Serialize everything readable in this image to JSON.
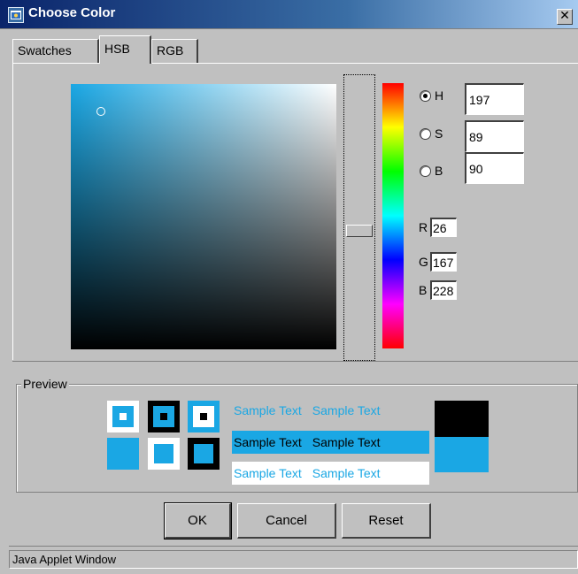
{
  "window": {
    "title": "Choose Color",
    "close_label": "✕"
  },
  "tabs": [
    {
      "label": "Swatches",
      "active": false
    },
    {
      "label": "HSB",
      "active": true
    },
    {
      "label": "RGB",
      "active": false
    }
  ],
  "hsb": {
    "selected_mode": "H",
    "h": {
      "label": "H",
      "value": "197"
    },
    "s": {
      "label": "S",
      "value": "89"
    },
    "b": {
      "label": "B",
      "value": "90"
    }
  },
  "rgb": {
    "r": {
      "label": "R",
      "value": "26"
    },
    "g": {
      "label": "G",
      "value": "167"
    },
    "b": {
      "label": "B",
      "value": "228"
    }
  },
  "colors": {
    "selected": "#1aa7e4",
    "black": "#000000",
    "white": "#ffffff",
    "face": "#c0c0c0"
  },
  "preview": {
    "label": "Preview",
    "sample_text": "Sample Text",
    "rows": [
      [
        "Sample Text",
        "Sample Text"
      ],
      [
        "Sample Text",
        "Sample Text"
      ],
      [
        "Sample Text",
        "Sample Text"
      ]
    ]
  },
  "buttons": {
    "ok": "OK",
    "cancel": "Cancel",
    "reset": "Reset"
  },
  "status_bar": {
    "text": "Java Applet Window"
  }
}
